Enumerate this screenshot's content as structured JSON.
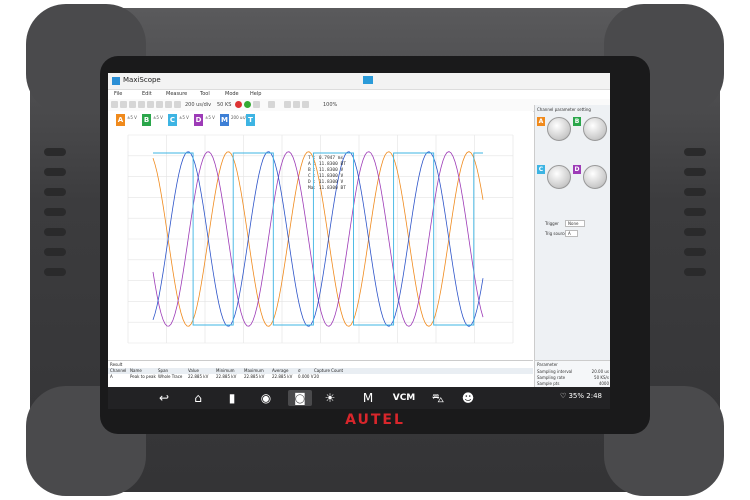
{
  "device": {
    "brand": "AUTEL",
    "accent": "#d8262b"
  },
  "window": {
    "title": "MaxiScope"
  },
  "menu": [
    "File",
    "Edit",
    "Measure",
    "Tool",
    "Mode",
    "Help"
  ],
  "toolbar": {
    "timebase": "200 us/div",
    "samples": "50 KS",
    "extra": "100%"
  },
  "channels": [
    {
      "id": "A",
      "color": "#f08a1c",
      "range": "±5 V",
      "coupling": "DC"
    },
    {
      "id": "B",
      "color": "#2aa64a",
      "range": "±5 V",
      "coupling": "DC"
    },
    {
      "id": "C",
      "color": "#3db4e3",
      "range": "±5 V",
      "coupling": "DC"
    },
    {
      "id": "D",
      "color": "#9d3bb7",
      "range": "±5 V",
      "coupling": "DC"
    },
    {
      "id": "M",
      "color": "#3d7fd6",
      "range": "200 us/div",
      "coupling": ""
    },
    {
      "id": "T",
      "color": "#3db4e3",
      "range": "",
      "coupling": ""
    }
  ],
  "readout": [
    "T :   0.7947 ms",
    "A :  11.8300 BT",
    "B :  11.8300  V",
    "C :  11.8300  V",
    "D :  11.8300  V",
    "Ma: 11.8300 BT"
  ],
  "side_panel": {
    "title": "Channel parameter setting",
    "trigger_label": "Trigger",
    "trigger_value": "None",
    "trig_source_label": "Trig source",
    "trig_source_value": "A"
  },
  "result": {
    "title": "Result",
    "columns": [
      "Channel",
      "Name",
      "Span",
      "Value",
      "Minimum",
      "Maximum",
      "Average",
      "σ",
      "Capture Count"
    ],
    "rows": [
      [
        "A",
        "Peak to peak",
        "Whole Trace",
        "22.885 kV",
        "22.885 kV",
        "22.885 kV",
        "22.885 kV",
        "0.000 V",
        "20"
      ]
    ]
  },
  "parameter": {
    "title": "Parameter",
    "rows": [
      {
        "label": "Sampling interval",
        "value": "20.00 us"
      },
      {
        "label": "Sampling rate",
        "value": "50 KS/s"
      },
      {
        "label": "Sample pts",
        "value": "4000"
      }
    ]
  },
  "status": {
    "battery": "35%",
    "time": "2:48"
  },
  "navbar": [
    "back-icon",
    "home-icon",
    "recent-apps-icon",
    "browser-icon",
    "camera-icon",
    "display-icon",
    "maxi-icon",
    "vcm-icon",
    "car-icon",
    "user-icon"
  ]
}
